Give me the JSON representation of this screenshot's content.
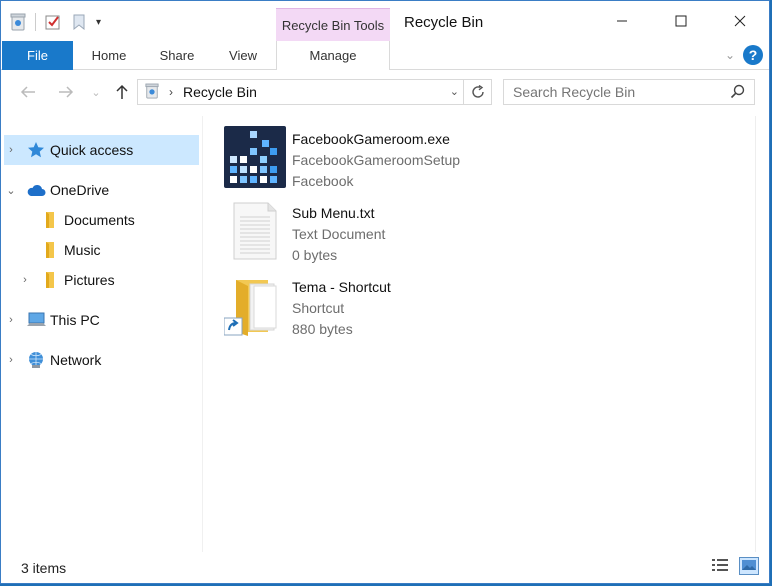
{
  "window": {
    "title": "Recycle Bin",
    "contextual_group": "Recycle Bin Tools",
    "controls": [
      "minimize-icon",
      "maximize-icon",
      "close-icon"
    ]
  },
  "ribbon": {
    "tabs": {
      "file": "File",
      "home": "Home",
      "share": "Share",
      "view": "View",
      "manage": "Manage"
    },
    "help_glyph": "?"
  },
  "address": {
    "path": "Recycle Bin",
    "search_placeholder": "Search Recycle Bin"
  },
  "nav": {
    "items": [
      {
        "label": "Quick access",
        "icon": "star-icon",
        "expander": "›",
        "selected": true
      },
      {
        "label": "OneDrive",
        "icon": "cloud-icon",
        "expander": "⌄"
      },
      {
        "label": "Documents",
        "icon": "folder-icon"
      },
      {
        "label": "Music",
        "icon": "folder-icon"
      },
      {
        "label": "Pictures",
        "icon": "folder-icon",
        "expander": "›"
      },
      {
        "label": "This PC",
        "icon": "computer-icon",
        "expander": "›"
      },
      {
        "label": "Network",
        "icon": "network-icon",
        "expander": "›"
      }
    ]
  },
  "files": [
    {
      "name": "FacebookGameroom.exe",
      "line2": "FacebookGameroomSetup",
      "line3": "Facebook",
      "icon": "app-icon"
    },
    {
      "name": "Sub Menu.txt",
      "line2": "Text Document",
      "line3": "0 bytes",
      "icon": "text-file-icon"
    },
    {
      "name": "Tema - Shortcut",
      "line2": "Shortcut",
      "line3": "880 bytes",
      "icon": "folder-shortcut-icon"
    }
  ],
  "status": {
    "count": "3 items"
  },
  "colors": {
    "accent": "#1979ca",
    "contextual": "#f3d9f5",
    "selection": "#cce8ff"
  }
}
